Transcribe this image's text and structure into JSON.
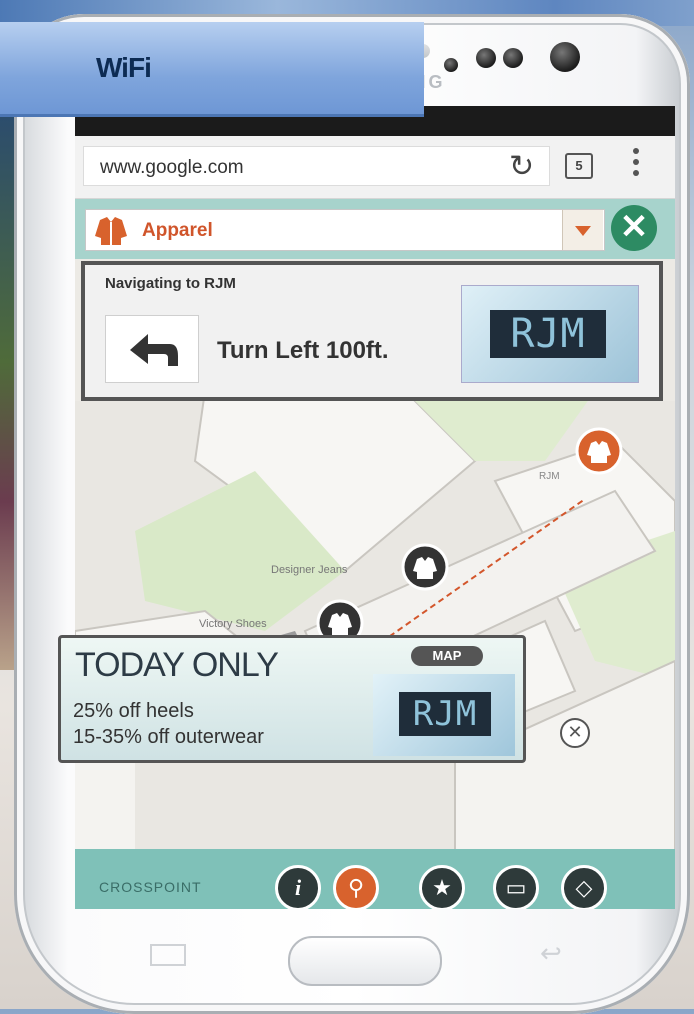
{
  "overlay": {
    "wifi_label": "WiFi"
  },
  "device": {
    "brand": "SAMSUNG"
  },
  "browser": {
    "url": "www.google.com",
    "tab_count": "5"
  },
  "app": {
    "category_label": "Apparel",
    "navigation": {
      "title": "Navigating to RJM",
      "instruction": "Turn Left 100ft.",
      "destination_logo": "RJM"
    },
    "map": {
      "labels": {
        "destination": "RJM",
        "store_1": "Designer Jeans",
        "store_2": "Victory Shoes"
      }
    },
    "promo": {
      "title": "TODAY ONLY",
      "line1": "25% off heels",
      "line2": "15-35% off outerwear",
      "badge": "MAP",
      "logo": "RJM"
    },
    "footer": {
      "brand": "CROSSPOINT",
      "buttons": [
        "info-icon",
        "location-pin-icon",
        "star-icon",
        "shopping-bag-icon",
        "map-icon"
      ]
    }
  },
  "colors": {
    "accent_orange": "#d8622d",
    "teal": "#7fc1b8",
    "dark_green": "#2d8b63",
    "route": "#d3562b"
  }
}
